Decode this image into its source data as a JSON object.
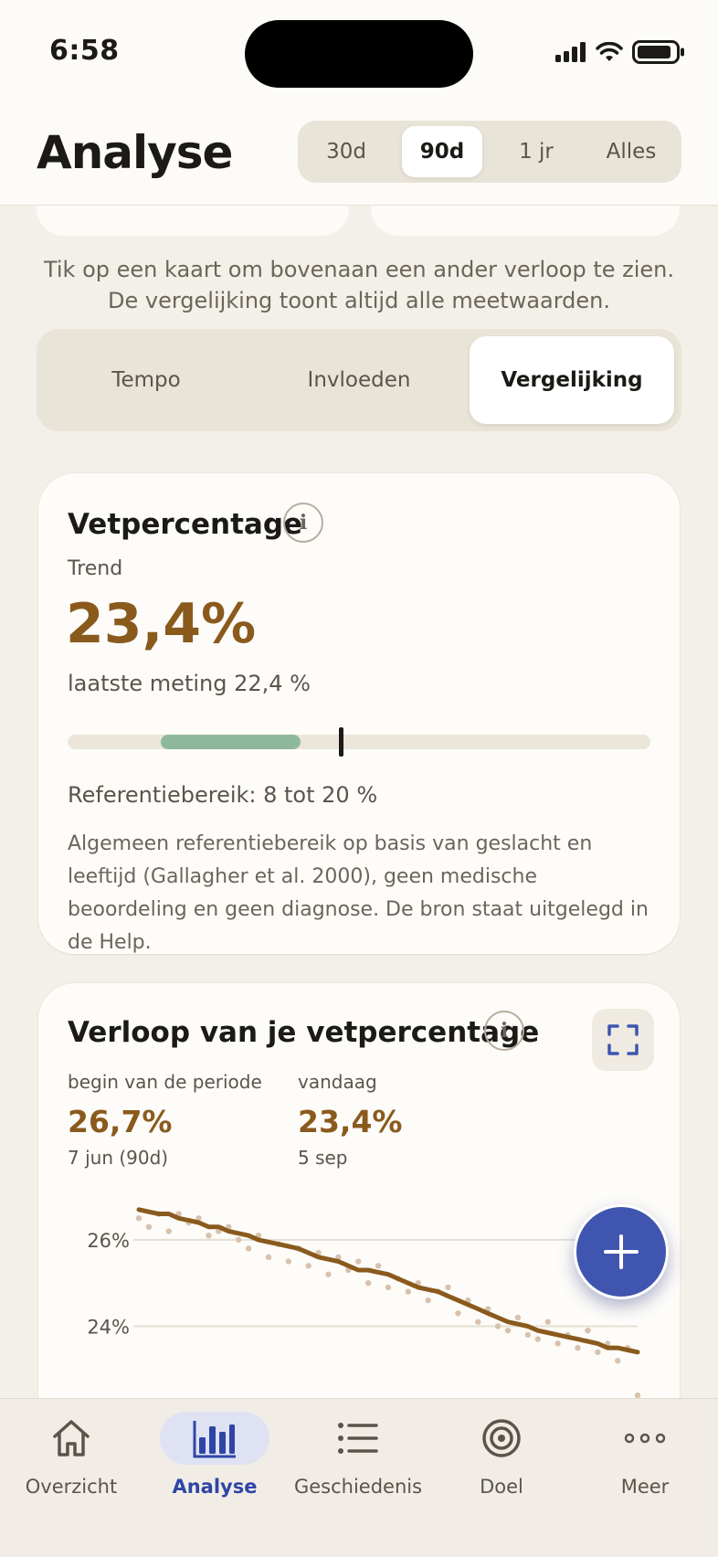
{
  "status": {
    "time": "6:58"
  },
  "header": {
    "title": "Analyse",
    "ranges": [
      {
        "label": "30d",
        "active": false
      },
      {
        "label": "90d",
        "active": true
      },
      {
        "label": "1 jr",
        "active": false
      },
      {
        "label": "Alles",
        "active": false
      }
    ]
  },
  "hint": "Tik op een kaart om bovenaan een ander verloop te zien. De vergelijking toont altijd alle meetwaarden.",
  "tabs": [
    {
      "label": "Tempo",
      "active": false
    },
    {
      "label": "Invloeden",
      "active": false
    },
    {
      "label": "Vergelijking",
      "active": true
    }
  ],
  "fat_card": {
    "title": "Vetpercentage",
    "info": "i",
    "subtitle": "Trend",
    "value": "23,4%",
    "last": "laatste meting 22,4 %",
    "scale": {
      "min": 0,
      "max": 50,
      "ref_min": 8,
      "ref_max": 20,
      "current": 23.4
    },
    "range": "Referentiebereik: 8 tot 20 %",
    "desc": "Algemeen referentiebereik op basis van geslacht en leeftijd (Gallagher et al. 2000), geen medische beoordeling en geen diagnose. De bron staat uitgelegd in de Help."
  },
  "trend_card": {
    "title": "Verloop van je vetpercentage",
    "info": "i",
    "start": {
      "label": "begin van de periode",
      "value": "26,7%",
      "date": "7 jun (90d)"
    },
    "end": {
      "label": "vandaag",
      "value": "23,4%",
      "date": "5 sep"
    }
  },
  "chart_data": {
    "type": "line",
    "y_ticks": [
      "26%",
      "24%"
    ],
    "y_tick_values": [
      26,
      24
    ],
    "ylim": [
      22,
      27.5
    ],
    "grid": true,
    "series": [
      {
        "values": [
          26.7,
          26.65,
          26.6,
          26.6,
          26.5,
          26.45,
          26.4,
          26.3,
          26.3,
          26.2,
          26.15,
          26.1,
          26.0,
          25.95,
          25.9,
          25.85,
          25.8,
          25.7,
          25.6,
          25.55,
          25.5,
          25.4,
          25.3,
          25.3,
          25.25,
          25.2,
          25.1,
          25.0,
          24.9,
          24.85,
          24.8,
          24.7,
          24.6,
          24.5,
          24.4,
          24.3,
          24.2,
          24.1,
          24.05,
          24.0,
          23.9,
          23.85,
          23.8,
          23.75,
          23.7,
          23.65,
          23.6,
          23.5,
          23.5,
          23.45,
          23.4
        ]
      }
    ],
    "points": [
      26.5,
      26.3,
      26.6,
      26.2,
      26.6,
      26.4,
      26.5,
      26.1,
      26.2,
      26.3,
      26.0,
      25.8,
      26.1,
      25.6,
      25.9,
      25.5,
      25.8,
      25.4,
      25.7,
      25.2,
      25.6,
      25.3,
      25.5,
      25.0,
      25.4,
      24.9,
      25.1,
      24.8,
      25.0,
      24.6,
      24.8,
      24.9,
      24.3,
      24.6,
      24.1,
      24.4,
      24.0,
      23.9,
      24.2,
      23.8,
      23.7,
      24.1,
      23.6,
      23.8,
      23.5,
      23.9,
      23.4,
      23.6,
      23.2,
      23.5,
      22.4
    ]
  },
  "fab": {
    "icon": "plus-icon"
  },
  "tabbar": [
    {
      "label": "Overzicht",
      "icon": "home-icon",
      "active": false
    },
    {
      "label": "Analyse",
      "icon": "bar-chart-icon",
      "active": true
    },
    {
      "label": "Geschiedenis",
      "icon": "list-icon",
      "active": false
    },
    {
      "label": "Doel",
      "icon": "target-icon",
      "active": false
    },
    {
      "label": "Meer",
      "icon": "more-icon",
      "active": false
    }
  ],
  "colors": {
    "accent": "#8a5a1d",
    "primary": "#3f55b0",
    "ref_green": "#8fb89a",
    "dots": "#d8c2ad"
  }
}
